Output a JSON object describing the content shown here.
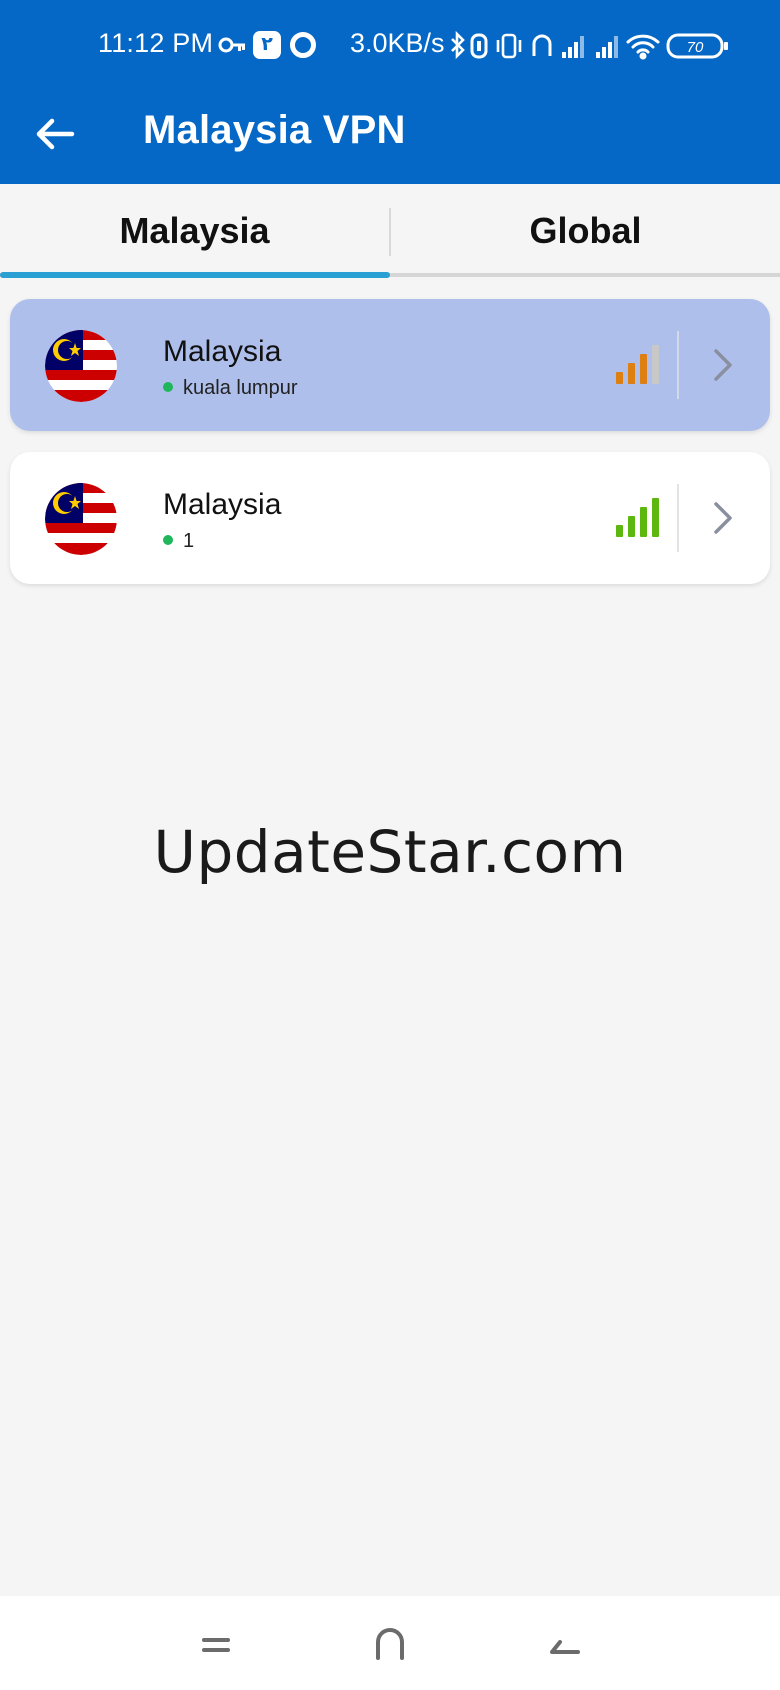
{
  "status_bar": {
    "time": "11:12 PM",
    "badge": "٢",
    "speed": "3.0KB/s",
    "battery": "70",
    "icons": [
      "key-icon",
      "notification-badge-icon",
      "ring-icon",
      "bluetooth-icon",
      "nfc-icon",
      "vibrate-icon",
      "headset-icon",
      "signal-icon",
      "signal-icon",
      "wifi-icon",
      "battery-icon"
    ]
  },
  "app_bar": {
    "title": "Malaysia VPN",
    "back_icon": "arrow-left-icon"
  },
  "tabs": [
    {
      "label": "Malaysia",
      "selected": true
    },
    {
      "label": "Global",
      "selected": false
    }
  ],
  "servers": [
    {
      "name": "Malaysia",
      "location": "kuala lumpur",
      "signal_bars": 3,
      "signal_total": 4,
      "signal_color": "#de7f12",
      "selected": true
    },
    {
      "name": "Malaysia",
      "location": "1",
      "signal_bars": 4,
      "signal_total": 4,
      "signal_color": "#5cb80f",
      "selected": false
    }
  ],
  "watermark": "UpdateStar.com",
  "colors": {
    "primary": "#0568c6",
    "tab_indicator": "#2a9fd3",
    "selected_card": "#aebfeb",
    "online": "#1fb65c"
  }
}
